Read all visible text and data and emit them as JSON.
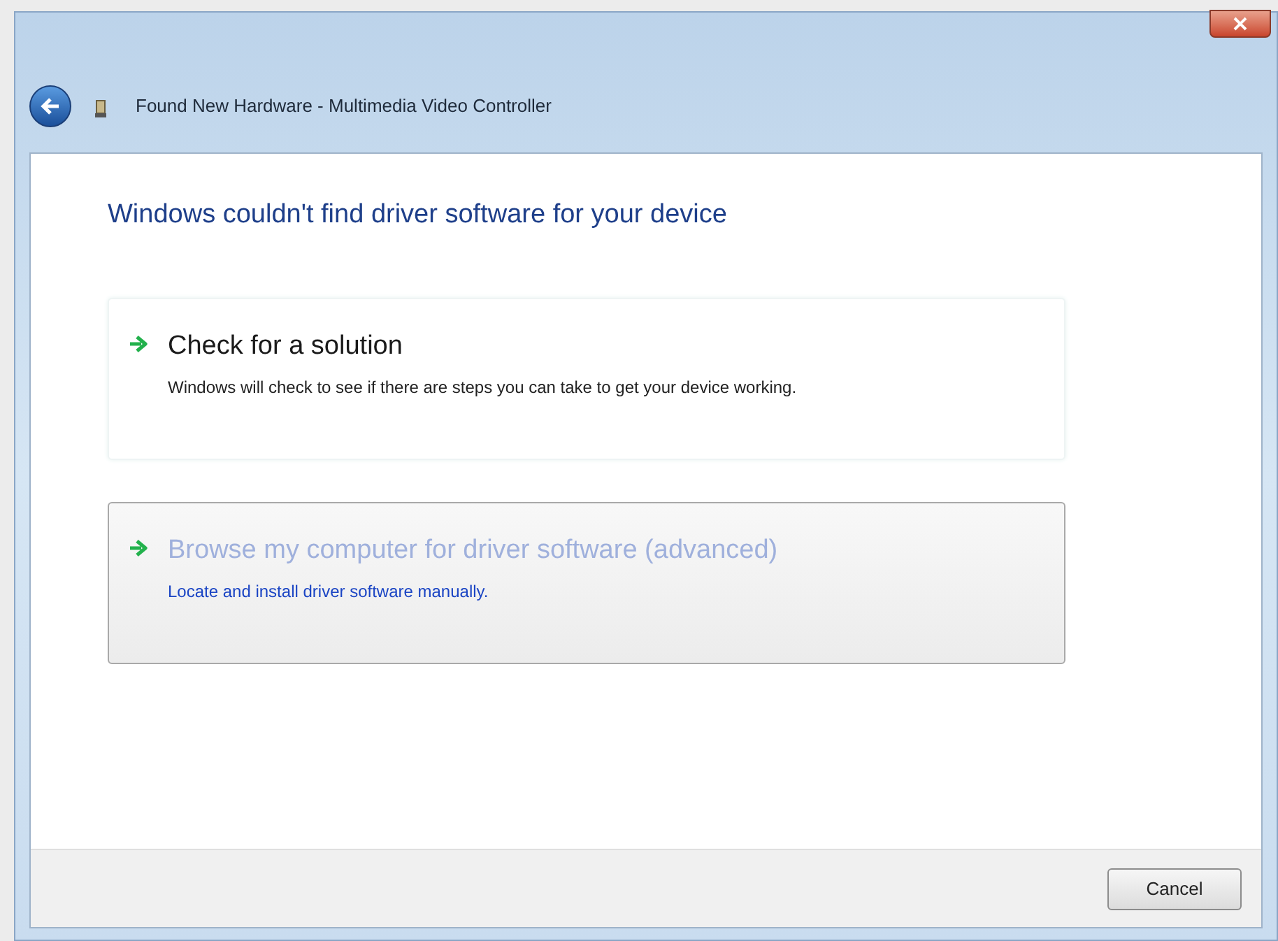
{
  "window": {
    "title": "Found New Hardware - Multimedia Video Controller"
  },
  "heading": "Windows couldn't find driver software for your device",
  "options": [
    {
      "title": "Check for a solution",
      "description": "Windows will check to see if there are steps you can take to get your device working.",
      "selected": false
    },
    {
      "title": "Browse my computer for driver software (advanced)",
      "description": "Locate and install driver software manually.",
      "selected": true
    }
  ],
  "buttons": [
    "Cancel"
  ]
}
